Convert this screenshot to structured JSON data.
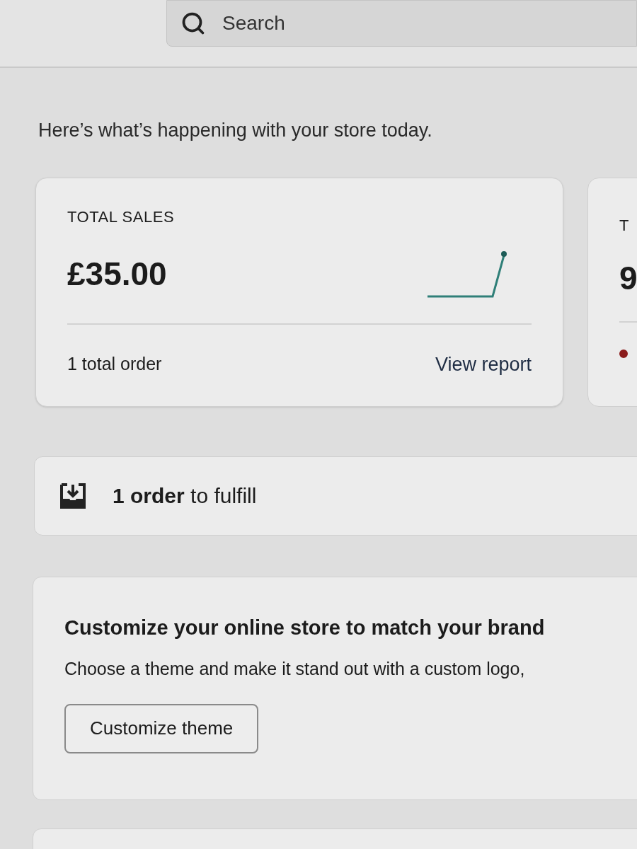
{
  "search": {
    "placeholder": "Search"
  },
  "intro": "Here’s what’s happening with your store today.",
  "sales_card": {
    "title": "TOTAL SALES",
    "amount": "£35.00",
    "footer": "1 total order",
    "link": "View report"
  },
  "next_card": {
    "title": "T",
    "amount": "9"
  },
  "fulfill": "**1 order** to fulfill",
  "customize": {
    "title": "Customize your online store to match your brand",
    "text": "Choose a theme and make it stand out with a custom logo,",
    "button": "Customize theme"
  }
}
